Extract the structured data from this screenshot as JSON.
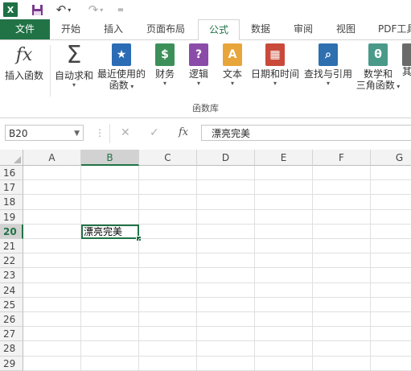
{
  "qat": {
    "logo": "X",
    "more": "="
  },
  "tabs": [
    "文件",
    "开始",
    "插入",
    "页面布局",
    "公式",
    "数据",
    "审阅",
    "视图",
    "PDF工具"
  ],
  "active_tab": "公式",
  "ribbon": {
    "buttons": [
      {
        "label": "插入函数",
        "label2": "",
        "icon": "fx-icon",
        "glyph": "fx",
        "color": "#444444"
      },
      {
        "label": "自动求和",
        "label2": "",
        "icon": "sigma-icon",
        "glyph": "Σ",
        "color": "#444444"
      },
      {
        "label": "最近使用的",
        "label2": "函数",
        "icon": "star-book-icon",
        "glyph": "★",
        "color": "#2b6cb5"
      },
      {
        "label": "财务",
        "label2": "",
        "icon": "coins-book-icon",
        "glyph": "$",
        "color": "#3d8f5a"
      },
      {
        "label": "逻辑",
        "label2": "",
        "icon": "question-book-icon",
        "glyph": "?",
        "color": "#8a4ca8"
      },
      {
        "label": "文本",
        "label2": "",
        "icon": "text-book-icon",
        "glyph": "A",
        "color": "#e8a53a"
      },
      {
        "label": "日期和时间",
        "label2": "",
        "icon": "calendar-book-icon",
        "glyph": "▦",
        "color": "#c94a3a"
      },
      {
        "label": "查找与引用",
        "label2": "",
        "icon": "magnifier-book-icon",
        "glyph": "⌕",
        "color": "#2e6fb0"
      },
      {
        "label": "数学和",
        "label2": "三角函数",
        "icon": "theta-book-icon",
        "glyph": "θ",
        "color": "#4a9a8a"
      },
      {
        "label": "其",
        "label2": "",
        "icon": "more-book-icon",
        "glyph": "",
        "color": "#6a6a6a"
      }
    ],
    "group_label": "函数库"
  },
  "formula_bar": {
    "name_box": "B20",
    "content": "漂亮完美",
    "cancel": "✕",
    "enter": "✓",
    "fx": "fx",
    "dots": "⋮"
  },
  "columns": [
    "A",
    "B",
    "C",
    "D",
    "E",
    "F",
    "G"
  ],
  "selected_column": "B",
  "rows": [
    "16",
    "17",
    "18",
    "19",
    "20",
    "21",
    "22",
    "23",
    "24",
    "25",
    "26",
    "27",
    "28",
    "29"
  ],
  "selected_row": "20",
  "active_cell": {
    "ref": "B20",
    "value": "漂亮完美"
  }
}
